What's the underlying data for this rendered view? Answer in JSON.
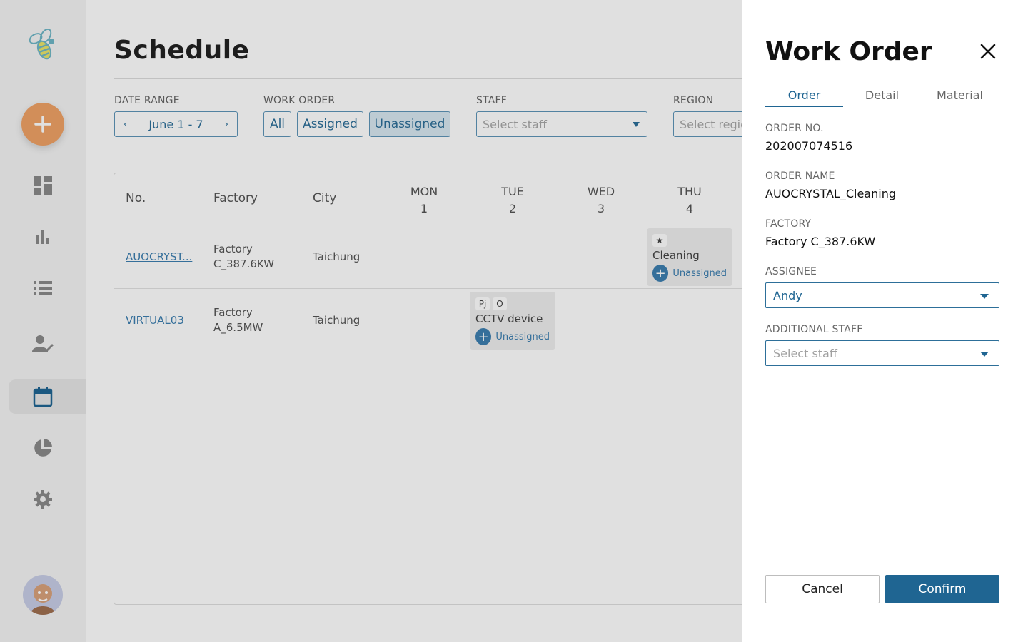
{
  "colors": {
    "accent": "#1f6592",
    "fab": "#f0a266",
    "link": "#3d7fb0"
  },
  "sidebar": {
    "icons": [
      "bee-logo-icon",
      "dashboard-icon",
      "bar-chart-icon",
      "list-icon",
      "user-edit-icon",
      "calendar-icon",
      "pie-chart-icon",
      "gear-icon"
    ],
    "active": "calendar-icon"
  },
  "page": {
    "title": "Schedule"
  },
  "filters": {
    "date_range": {
      "label": "DATE RANGE",
      "value": "June 1 - 7",
      "prev": "‹",
      "next": "›"
    },
    "work_order": {
      "label": "WORK ORDER",
      "options": [
        "All",
        "Assigned",
        "Unassigned"
      ],
      "selected": "Unassigned"
    },
    "staff": {
      "label": "STAFF",
      "placeholder": "Select staff"
    },
    "region": {
      "label": "REGION",
      "placeholder": "Select region"
    }
  },
  "table": {
    "columns": [
      "No.",
      "Factory",
      "City"
    ],
    "days": [
      {
        "name": "MON",
        "date": "1"
      },
      {
        "name": "TUE",
        "date": "2"
      },
      {
        "name": "WED",
        "date": "3"
      },
      {
        "name": "THU",
        "date": "4"
      }
    ],
    "rows": [
      {
        "no": "AUOCRYST...",
        "factory_line1": "Factory",
        "factory_line2": "C_387.6KW",
        "city": "Taichung",
        "task": {
          "day": "THU",
          "tags": [
            "★"
          ],
          "title": "Cleaning",
          "assignee": "Unassigned"
        }
      },
      {
        "no": "VIRTUAL03",
        "factory_line1": "Factory",
        "factory_line2": "A_6.5MW",
        "city": "Taichung",
        "task": {
          "day": "TUE",
          "tags": [
            "Pj",
            "O"
          ],
          "title": "CCTV device",
          "assignee": "Unassigned"
        }
      }
    ]
  },
  "panel": {
    "title": "Work Order",
    "tabs": [
      "Order",
      "Detail",
      "Material"
    ],
    "active_tab": "Order",
    "order_no": {
      "label": "ORDER NO.",
      "value": "202007074516"
    },
    "order_name": {
      "label": "ORDER NAME",
      "value": "AUOCRYSTAL_Cleaning"
    },
    "factory": {
      "label": "FACTORY",
      "value": "Factory C_387.6KW"
    },
    "assignee": {
      "label": "ASSIGNEE",
      "value": "Andy"
    },
    "additional_staff": {
      "label": "ADDITIONAL STAFF",
      "placeholder": "Select staff"
    },
    "cancel_label": "Cancel",
    "confirm_label": "Confirm"
  }
}
